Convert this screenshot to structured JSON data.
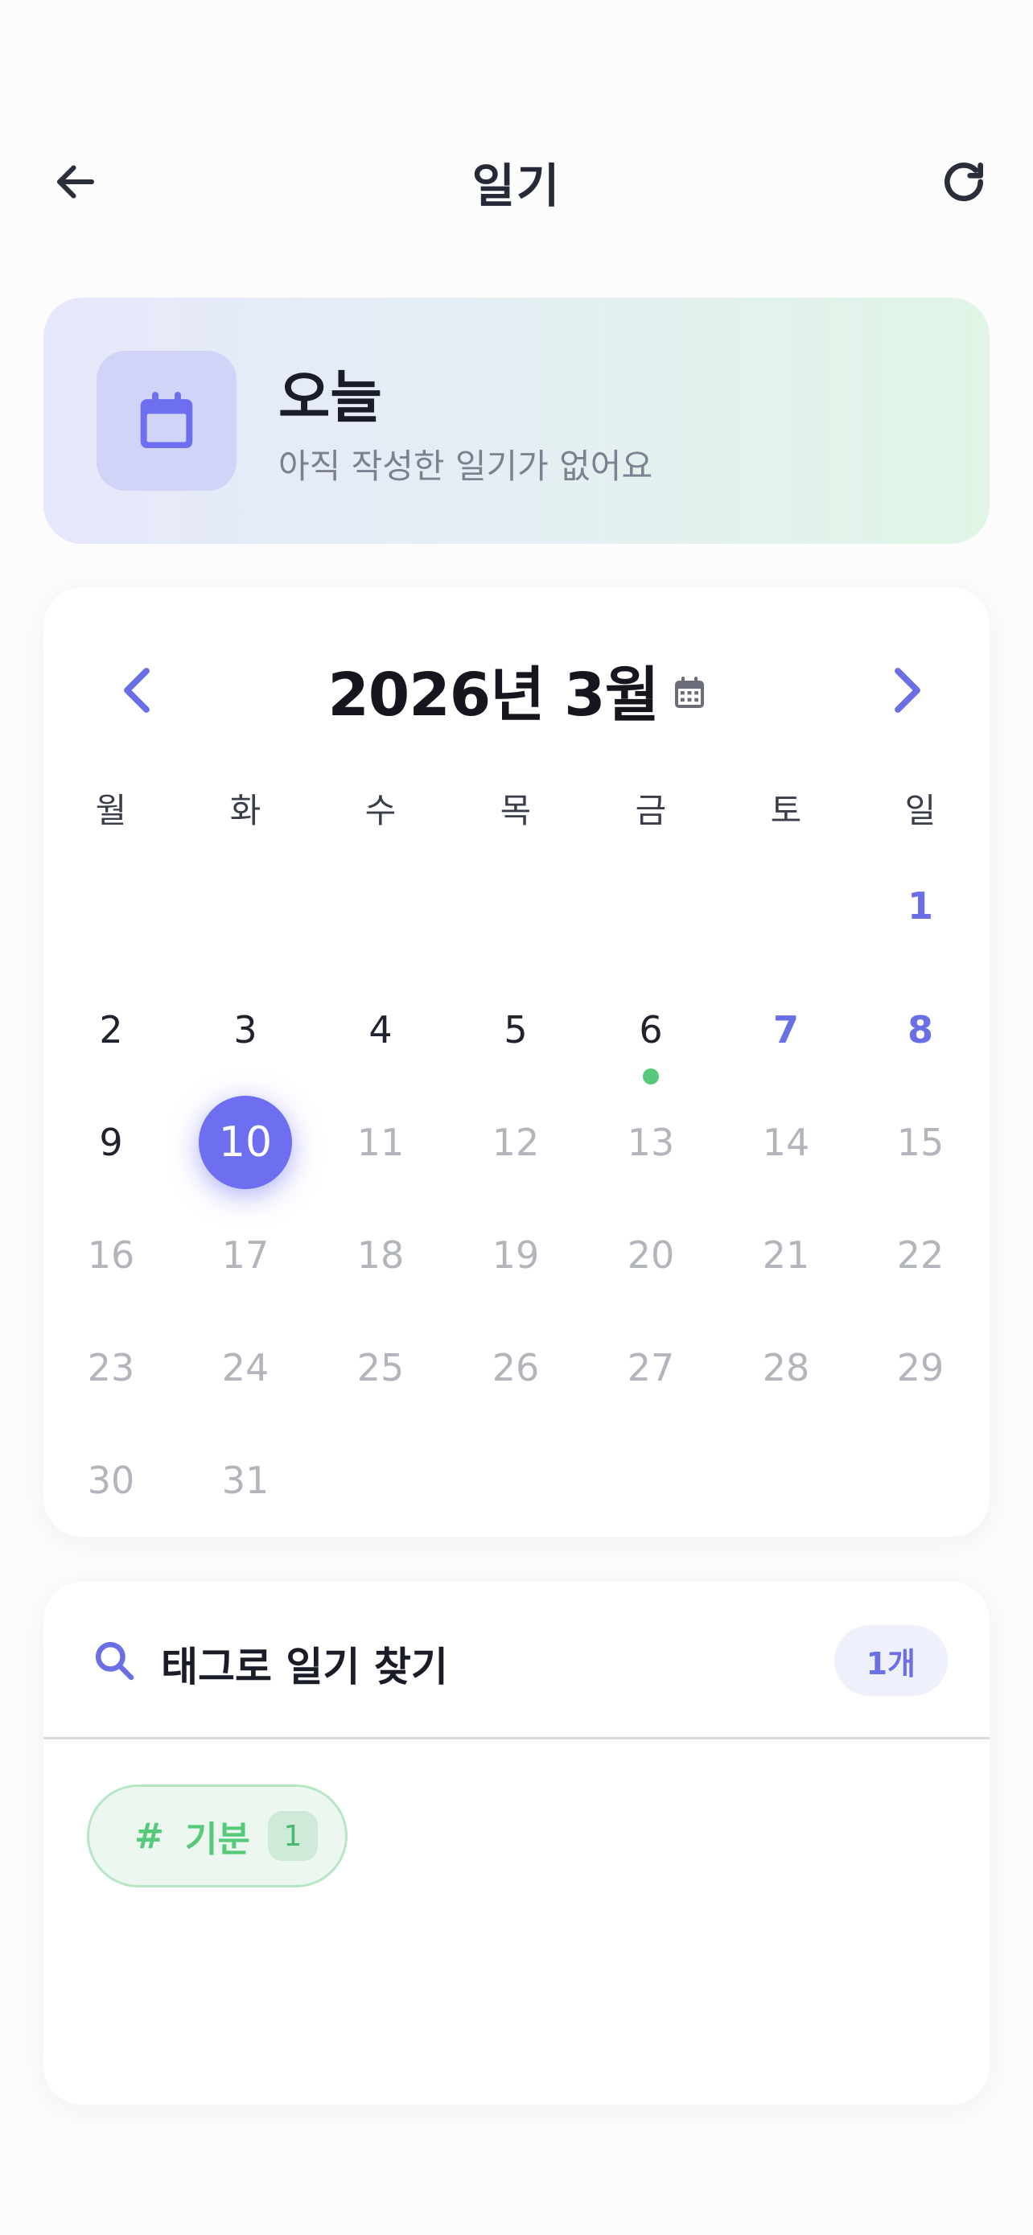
{
  "header": {
    "title": "일기",
    "back_icon": "arrow-left-icon",
    "refresh_icon": "refresh-icon"
  },
  "today_card": {
    "title": "오늘",
    "subtitle": "아직 작성한 일기가 없어요",
    "icon": "calendar-icon"
  },
  "calendar": {
    "month_label": "2026년 3월",
    "weekdays": [
      "월",
      "화",
      "수",
      "목",
      "금",
      "토",
      "일"
    ],
    "days": [
      {
        "label": "1",
        "state": "weekend"
      },
      {
        "label": "2",
        "state": "past"
      },
      {
        "label": "3",
        "state": "past"
      },
      {
        "label": "4",
        "state": "past"
      },
      {
        "label": "5",
        "state": "past"
      },
      {
        "label": "6",
        "state": "past",
        "has_entry": true
      },
      {
        "label": "7",
        "state": "weekend"
      },
      {
        "label": "8",
        "state": "weekend"
      },
      {
        "label": "9",
        "state": "past"
      },
      {
        "label": "10",
        "state": "today"
      },
      {
        "label": "11",
        "state": "future"
      },
      {
        "label": "12",
        "state": "future"
      },
      {
        "label": "13",
        "state": "future"
      },
      {
        "label": "14",
        "state": "future"
      },
      {
        "label": "15",
        "state": "future"
      },
      {
        "label": "16",
        "state": "future"
      },
      {
        "label": "17",
        "state": "future"
      },
      {
        "label": "18",
        "state": "future"
      },
      {
        "label": "19",
        "state": "future"
      },
      {
        "label": "20",
        "state": "future"
      },
      {
        "label": "21",
        "state": "future"
      },
      {
        "label": "22",
        "state": "future"
      },
      {
        "label": "23",
        "state": "future"
      },
      {
        "label": "24",
        "state": "future"
      },
      {
        "label": "25",
        "state": "future"
      },
      {
        "label": "26",
        "state": "future"
      },
      {
        "label": "27",
        "state": "future"
      },
      {
        "label": "28",
        "state": "future"
      },
      {
        "label": "29",
        "state": "future"
      },
      {
        "label": "30",
        "state": "future"
      },
      {
        "label": "31",
        "state": "future"
      }
    ]
  },
  "tag_search": {
    "title": "태그로 일기 찾기",
    "count_label": "1개",
    "tags": [
      {
        "hash": "#",
        "label": "기분",
        "count": "1"
      }
    ]
  },
  "colors": {
    "accent": "#6d6ff0",
    "entry_dot": "#56c97a",
    "tag_green": "#56c97a"
  }
}
